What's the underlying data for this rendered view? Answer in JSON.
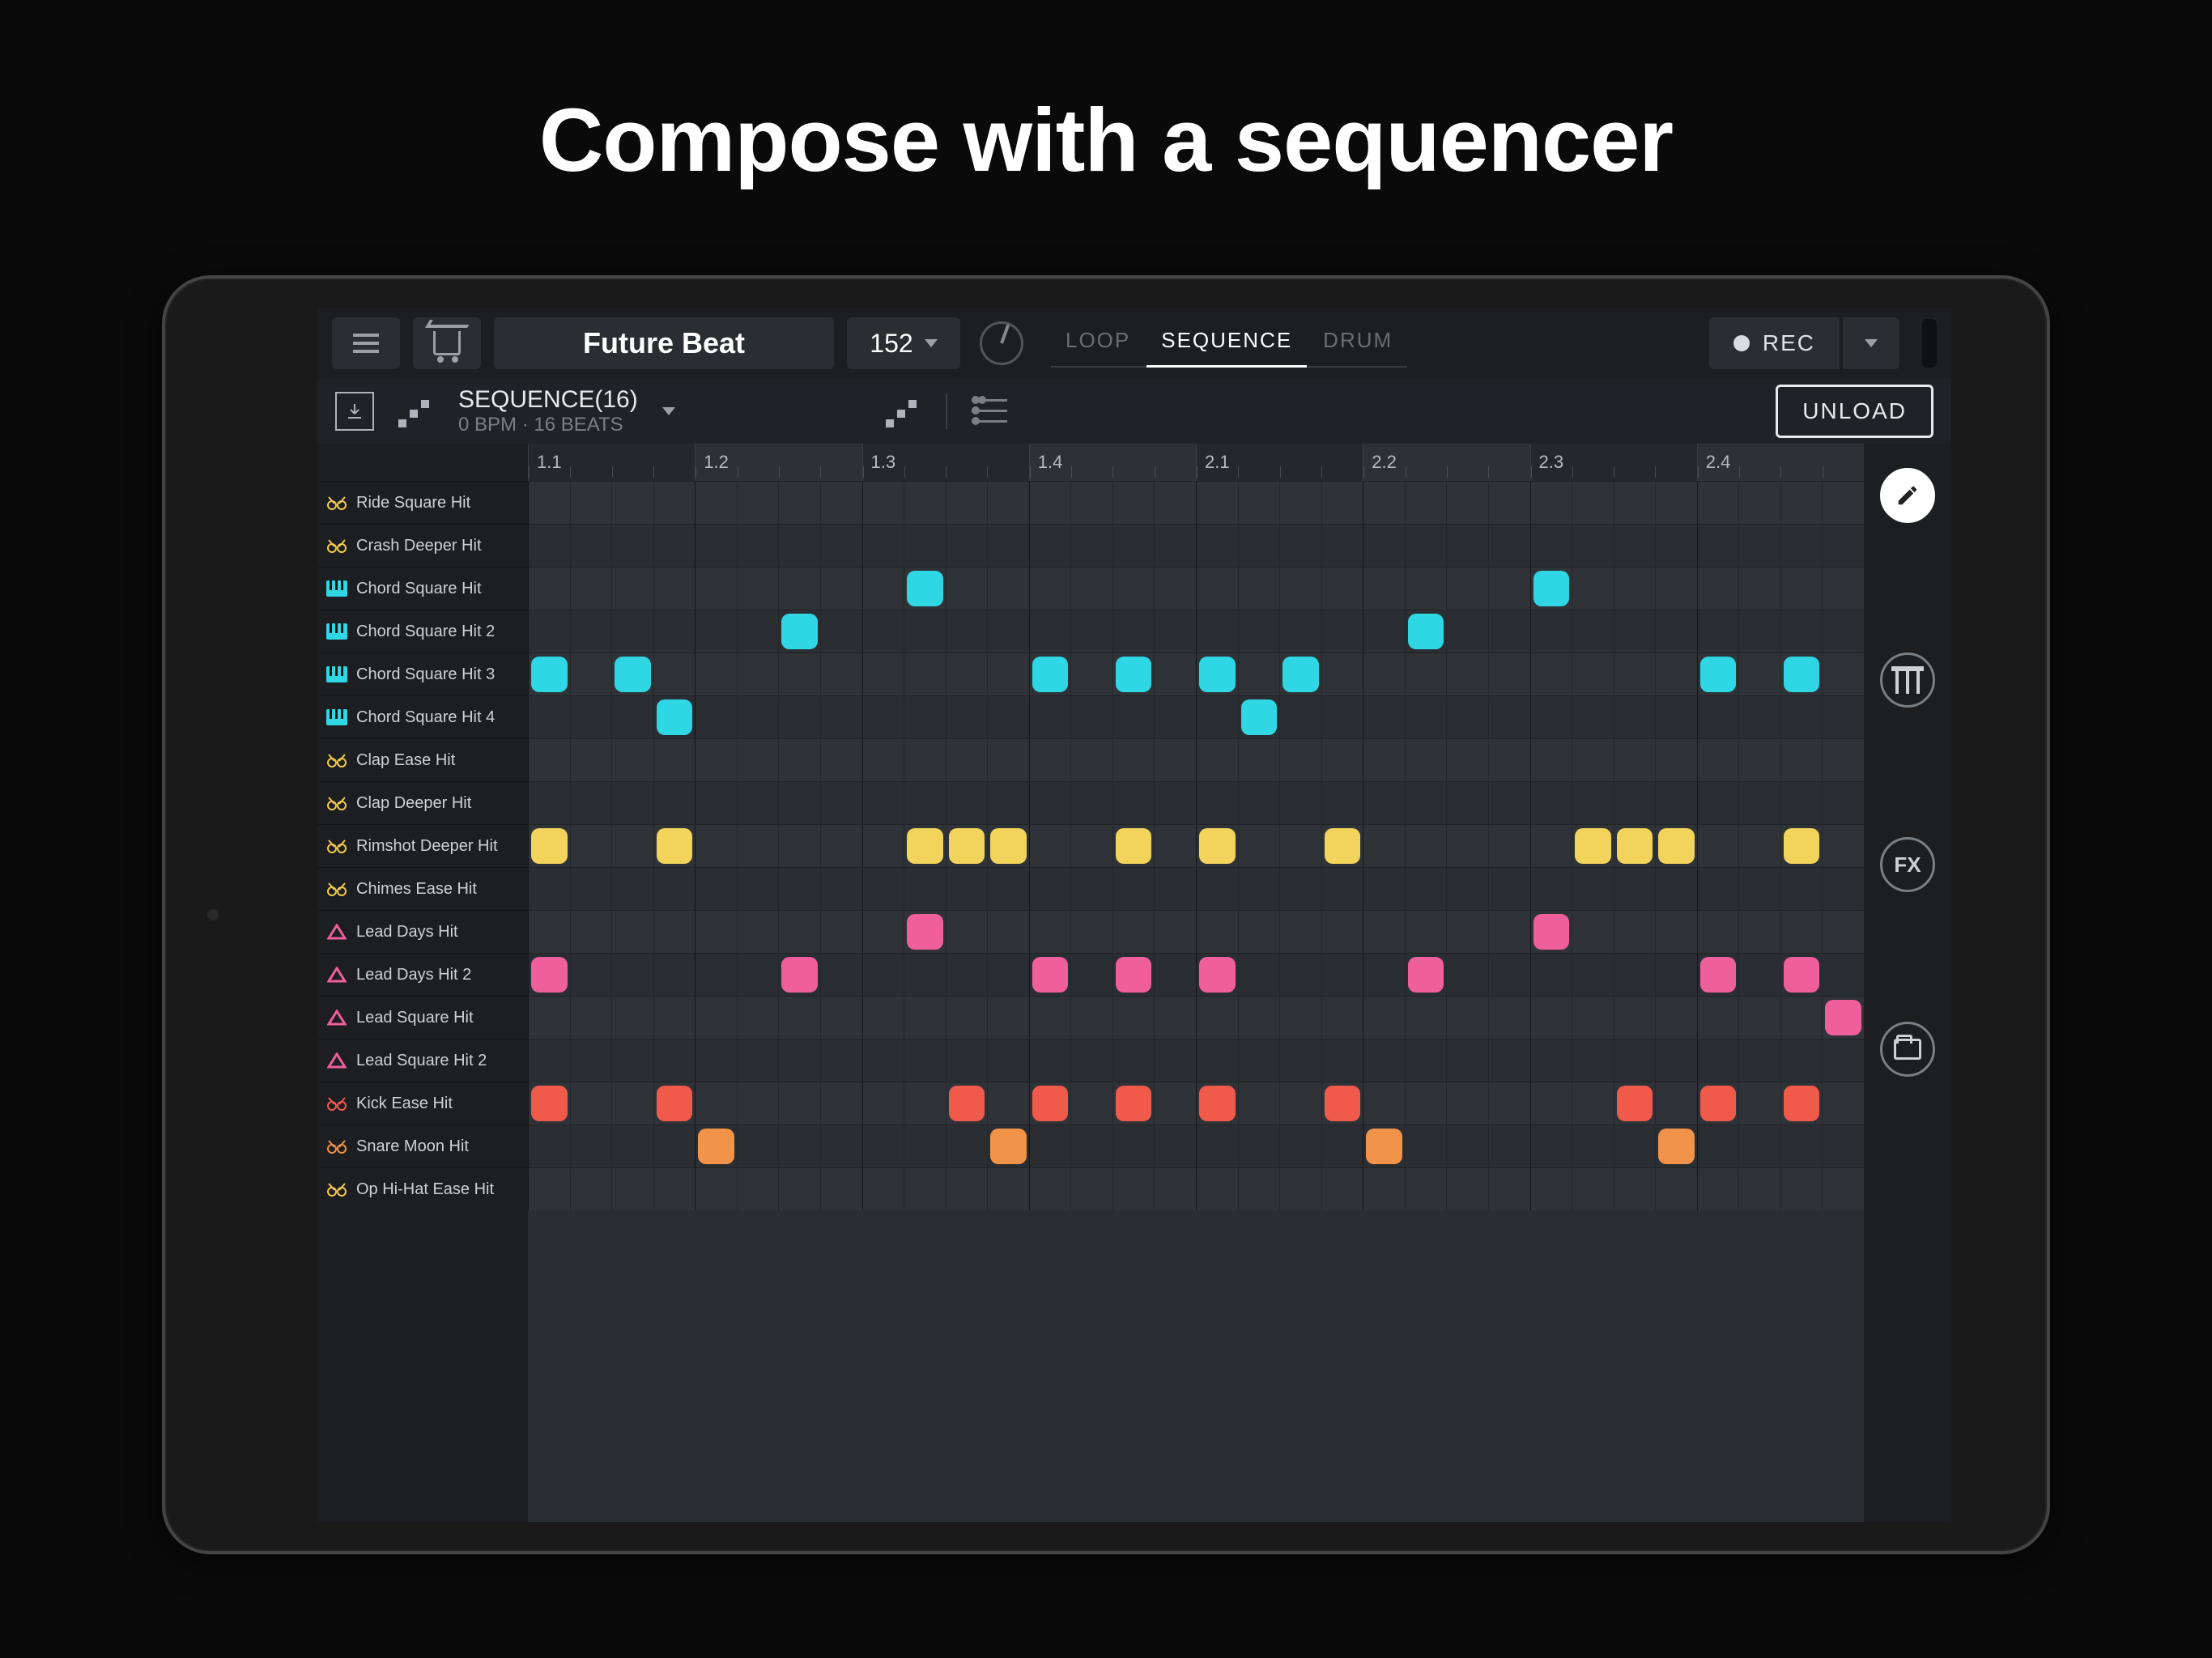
{
  "headline": "Compose with a sequencer",
  "toolbar": {
    "project": "Future Beat",
    "bpm": "152",
    "modes": [
      "LOOP",
      "SEQUENCE",
      "DRUM"
    ],
    "active_mode": 1,
    "rec_label": "REC"
  },
  "subheader": {
    "title": "SEQUENCE(16)",
    "subtitle": "0 BPM · 16 BEATS",
    "unload": "UNLOAD"
  },
  "ruler": [
    "1.1",
    "1.2",
    "1.3",
    "1.4",
    "2.1",
    "2.2",
    "2.3",
    "2.4"
  ],
  "grid_steps": 32,
  "colors": {
    "cyan": "#2fd6e3",
    "yellow": "#f2d35b",
    "pink": "#ee5f9b",
    "red": "#f05a4a",
    "orange": "#f2934a"
  },
  "tracks": [
    {
      "name": "Ride Square Hit",
      "icon": "drum",
      "icolor": "#f2c94c",
      "notes": []
    },
    {
      "name": "Crash Deeper Hit",
      "icon": "drum",
      "icolor": "#f2c94c",
      "notes": []
    },
    {
      "name": "Chord Square Hit",
      "icon": "keys",
      "icolor": "#2fd6e3",
      "color": "cyan",
      "notes": [
        9,
        24
      ]
    },
    {
      "name": "Chord Square Hit 2",
      "icon": "keys",
      "icolor": "#2fd6e3",
      "color": "cyan",
      "notes": [
        6,
        21
      ]
    },
    {
      "name": "Chord Square Hit 3",
      "icon": "keys",
      "icolor": "#2fd6e3",
      "color": "cyan",
      "notes": [
        0,
        2,
        12,
        14,
        16,
        18,
        28,
        30
      ]
    },
    {
      "name": "Chord Square Hit 4",
      "icon": "keys",
      "icolor": "#2fd6e3",
      "color": "cyan",
      "notes": [
        3,
        17
      ]
    },
    {
      "name": "Clap Ease Hit",
      "icon": "drum",
      "icolor": "#f2c94c",
      "notes": []
    },
    {
      "name": "Clap Deeper Hit",
      "icon": "drum",
      "icolor": "#f2c94c",
      "notes": []
    },
    {
      "name": "Rimshot Deeper Hit",
      "icon": "drum",
      "icolor": "#f2c94c",
      "color": "yellow",
      "notes": [
        0,
        3,
        9,
        10,
        11,
        14,
        16,
        19,
        25,
        26,
        27,
        30
      ]
    },
    {
      "name": "Chimes Ease Hit",
      "icon": "drum",
      "icolor": "#f2c94c",
      "notes": []
    },
    {
      "name": "Lead Days Hit",
      "icon": "tri",
      "icolor": "#ee5f9b",
      "color": "pink",
      "notes": [
        9,
        24
      ]
    },
    {
      "name": "Lead Days Hit 2",
      "icon": "tri",
      "icolor": "#ee5f9b",
      "color": "pink",
      "notes": [
        0,
        6,
        12,
        14,
        16,
        21,
        28,
        30
      ]
    },
    {
      "name": "Lead Square Hit",
      "icon": "tri",
      "icolor": "#ee5f9b",
      "color": "pink",
      "notes": [
        31
      ]
    },
    {
      "name": "Lead Square Hit 2",
      "icon": "tri",
      "icolor": "#ee5f9b",
      "notes": []
    },
    {
      "name": "Kick Ease Hit",
      "icon": "drum",
      "icolor": "#f05a4a",
      "color": "red",
      "notes": [
        0,
        3,
        10,
        12,
        14,
        16,
        19,
        26,
        28,
        30
      ]
    },
    {
      "name": "Snare Moon Hit",
      "icon": "drum",
      "icolor": "#f2934a",
      "color": "orange",
      "notes": [
        4,
        11,
        20,
        27
      ]
    },
    {
      "name": "Op Hi-Hat Ease Hit",
      "icon": "drum",
      "icolor": "#f2c94c",
      "notes": []
    }
  ],
  "side": {
    "fx_label": "FX"
  }
}
